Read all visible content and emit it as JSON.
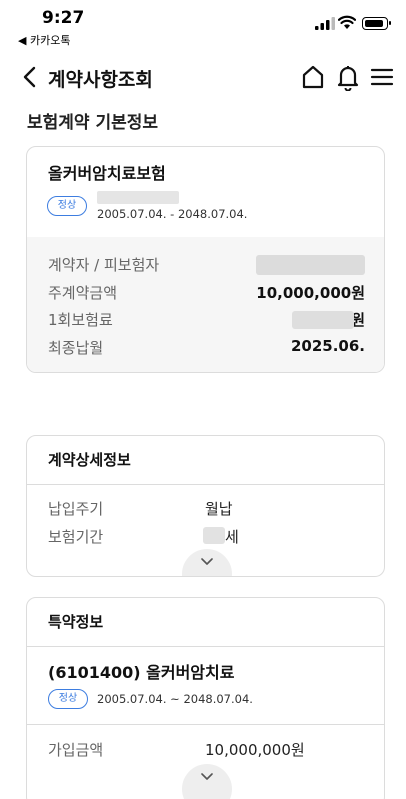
{
  "status_bar": {
    "time": "9:27",
    "back_app": "◀ 카카오톡"
  },
  "header": {
    "title": "계약사항조회"
  },
  "section_title": "보험계약 기본정보",
  "contract": {
    "product_name": "올커버암치료보험",
    "status": "정상",
    "period": "2005.07.04. - 2048.07.04.",
    "rows": [
      {
        "label": "계약자 / 피보험자",
        "value": ""
      },
      {
        "label": "주계약금액",
        "value": "10,000,000원"
      },
      {
        "label": "1회보험료",
        "value": "원"
      },
      {
        "label": "최종납월",
        "value": "2025.06."
      }
    ]
  },
  "detail": {
    "title": "계약상세정보",
    "rows": [
      {
        "label": "납입주기",
        "value": "월납"
      },
      {
        "label": "보험기간",
        "value": "세"
      }
    ]
  },
  "rider": {
    "title": "특약정보",
    "name": "(6101400) 올커버암치료",
    "status": "정상",
    "period": "2005.07.04. ~ 2048.07.04.",
    "rows": [
      {
        "label": "가입금액",
        "value": "10,000,000원"
      }
    ]
  },
  "colors": {
    "accent": "#3d7de0",
    "card_border": "#dcdcdc",
    "grey_area": "#f6f6f6"
  }
}
